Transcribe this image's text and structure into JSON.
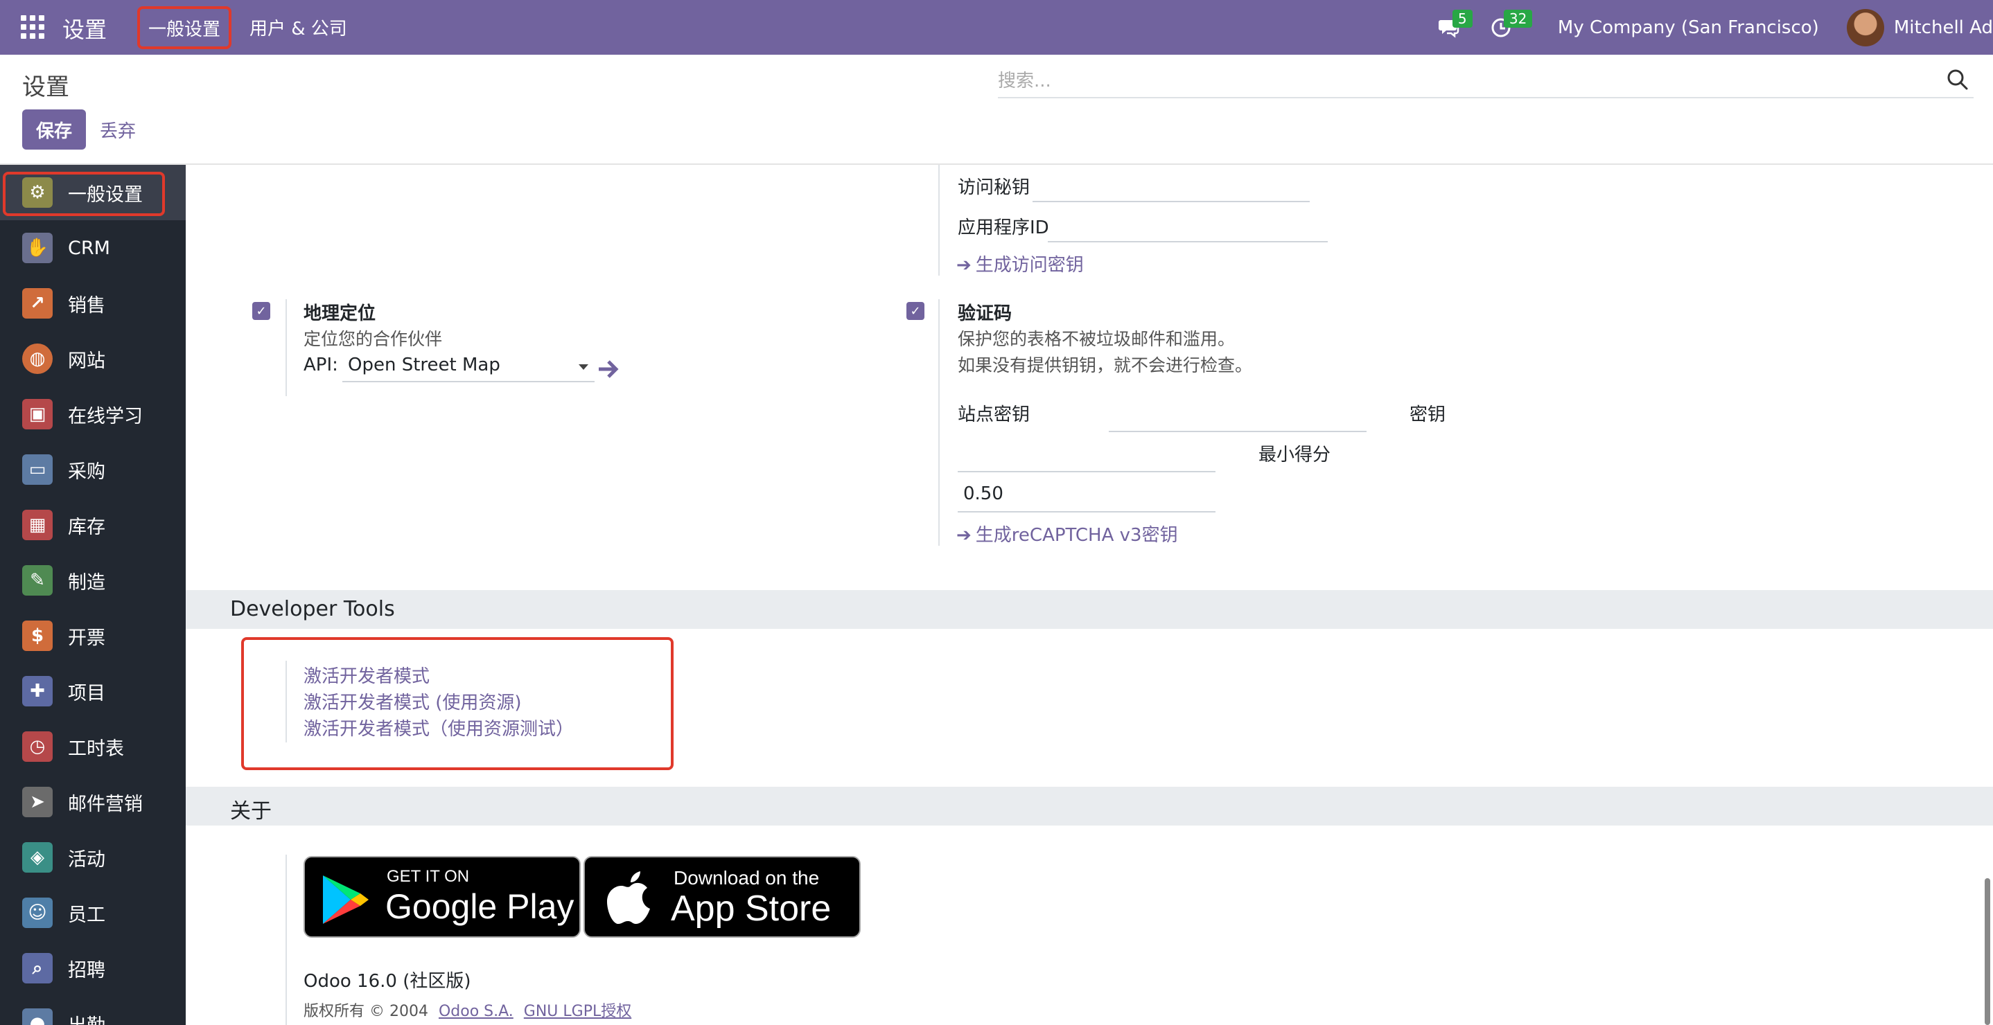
{
  "navbar": {
    "brand": "设置",
    "menu_general": "一般设置",
    "menu_users": "用户 & 公司",
    "messages_count": "5",
    "activities_count": "32",
    "company": "My Company (San Francisco)",
    "user": "Mitchell Ad"
  },
  "control_panel": {
    "title": "设置",
    "search_placeholder": "搜索...",
    "save": "保存",
    "discard": "丢弃"
  },
  "sidebar": {
    "items": [
      {
        "label": "一般设置",
        "icon": "gear-icon",
        "color": "#8c8a4a"
      },
      {
        "label": "CRM",
        "icon": "handshake-icon",
        "color": "#6a6f8e"
      },
      {
        "label": "销售",
        "icon": "chart-icon",
        "color": "#d06c3b"
      },
      {
        "label": "网站",
        "icon": "globe-icon",
        "color": "#d06c3b"
      },
      {
        "label": "在线学习",
        "icon": "elearning-icon",
        "color": "#b5484a"
      },
      {
        "label": "采购",
        "icon": "card-icon",
        "color": "#5d7ba3"
      },
      {
        "label": "库存",
        "icon": "box-icon",
        "color": "#b5484a"
      },
      {
        "label": "制造",
        "icon": "wrench-icon",
        "color": "#4f8a52"
      },
      {
        "label": "开票",
        "icon": "invoice-icon",
        "color": "#d06c3b"
      },
      {
        "label": "项目",
        "icon": "puzzle-icon",
        "color": "#5d6aa3"
      },
      {
        "label": "工时表",
        "icon": "stopwatch-icon",
        "color": "#b5484a"
      },
      {
        "label": "邮件营销",
        "icon": "paper-plane-icon",
        "color": "#6b6b6b"
      },
      {
        "label": "活动",
        "icon": "ticket-icon",
        "color": "#3a8f86"
      },
      {
        "label": "员工",
        "icon": "people-icon",
        "color": "#4f7fa8"
      },
      {
        "label": "招聘",
        "icon": "magnifier-icon",
        "color": "#5d6aa3"
      },
      {
        "label": "出勤",
        "icon": "user-icon",
        "color": "#5d7ba3"
      }
    ]
  },
  "unsplash": {
    "access_key_label": "访问秘钥",
    "app_id_label": "应用程序ID",
    "generate_link": "生成访问密钥"
  },
  "geolocation": {
    "title": "地理定位",
    "description": "定位您的合作伙伴",
    "api_label": "API:",
    "api_value": "Open Street Map"
  },
  "recaptcha": {
    "title": "验证码",
    "desc1": "保护您的表格不被垃圾邮件和滥用。",
    "desc2": "如果没有提供钥钥，就不会进行检查。",
    "site_key_label": "站点密钥",
    "secret_key_label": "密钥",
    "min_score_label": "最小得分",
    "min_score_value": "0.50",
    "generate_link": "生成reCAPTCHA v3密钥"
  },
  "developer_tools": {
    "title": "Developer Tools",
    "links": [
      "激活开发者模式",
      "激活开发者模式 (使用资源)",
      "激活开发者模式（使用资源测试）"
    ]
  },
  "about": {
    "title": "关于",
    "google_play_top": "GET IT ON",
    "google_play_bottom": "Google Play",
    "app_store_top": "Download on the",
    "app_store_bottom": "App Store",
    "version": "Odoo 16.0 (社区版)",
    "copyright": "版权所有 © 2004",
    "company_link": "Odoo S.A.",
    "license_link": "GNU LGPL授权"
  }
}
